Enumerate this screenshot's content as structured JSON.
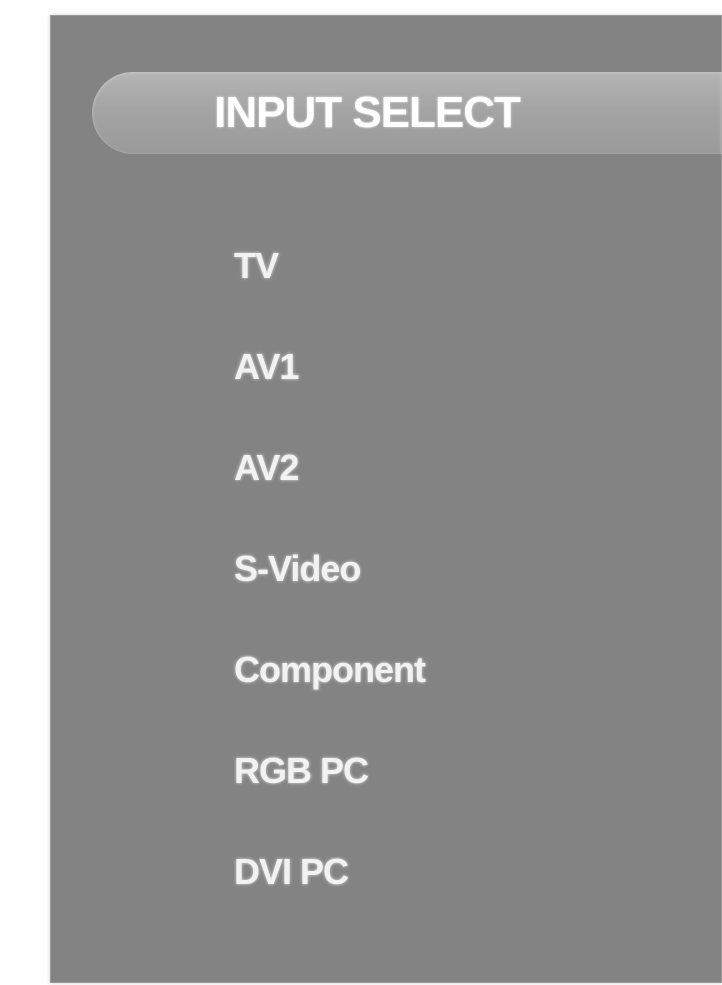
{
  "osd_menu": {
    "title": "INPUT SELECT",
    "items": [
      {
        "label": "TV"
      },
      {
        "label": "AV1"
      },
      {
        "label": "AV2"
      },
      {
        "label": "S-Video"
      },
      {
        "label": "Component"
      },
      {
        "label": "RGB PC"
      },
      {
        "label": "DVI PC"
      }
    ]
  },
  "colors": {
    "panel": "#838383",
    "title_bar": "#a8a8a8",
    "text": "#ffffff"
  }
}
